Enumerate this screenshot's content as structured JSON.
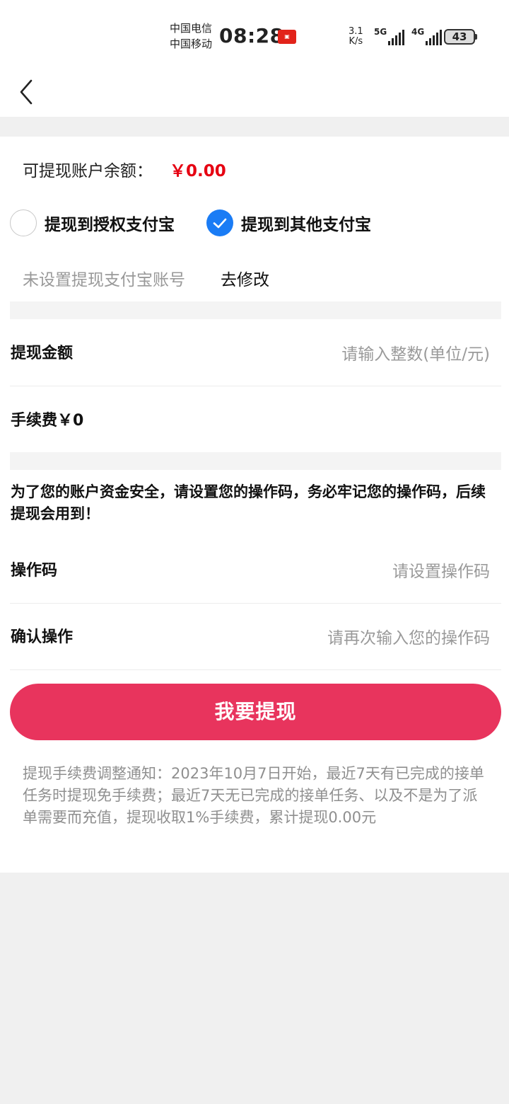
{
  "status_bar": {
    "carrier1": "中国电信",
    "carrier2": "中国移动",
    "time": "08:28",
    "speed_value": "3.1",
    "speed_unit": "K/s",
    "net1": "5G",
    "net2": "4G",
    "battery": "43"
  },
  "balance": {
    "label": "可提现账户余额：",
    "value": "￥0.00"
  },
  "options": [
    {
      "label": "提现到授权支付宝",
      "selected": false
    },
    {
      "label": "提现到其他支付宝",
      "selected": true
    }
  ],
  "account": {
    "hint": "未设置提现支付宝账号",
    "edit_label": "去修改"
  },
  "amount": {
    "label": "提现金额",
    "placeholder": "请输入整数(单位/元)"
  },
  "fee": {
    "label": "手续费￥0"
  },
  "security_notice": "为了您的账户资金安全，请设置您的操作码，务必牢记您的操作码，后续提现会用到！",
  "op_code": {
    "label": "操作码",
    "placeholder": "请设置操作码"
  },
  "confirm_code": {
    "label": "确认操作",
    "placeholder": "请再次输入您的操作码"
  },
  "submit_label": "我要提现",
  "fee_notice": "提现手续费调整通知：2023年10月7日开始，最近7天有已完成的接单任务时提现免手续费；最近7天无已完成的接单任务、以及不是为了派单需要而充值，提现收取1%手续费，累计提现0.00元",
  "colors": {
    "accent_blue": "#1a7cf5",
    "submit_pink": "#e8345d",
    "balance_red": "#e60012"
  }
}
